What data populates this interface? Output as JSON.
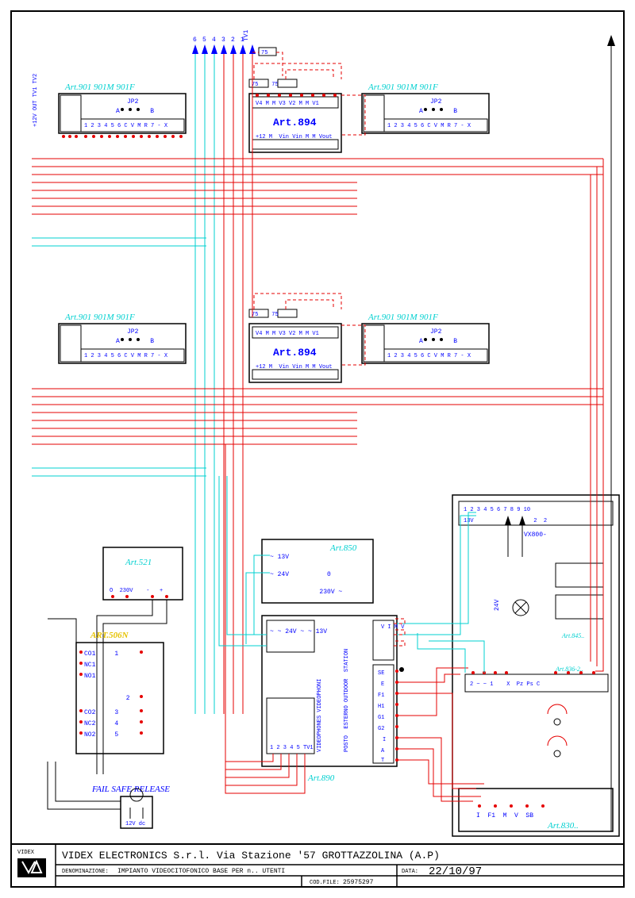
{
  "bus": {
    "labels": [
      "6",
      "5",
      "4",
      "3",
      "2",
      "1",
      "TV1"
    ],
    "resistor": "75"
  },
  "blocks": {
    "videophone": {
      "title": "Art.901 901M 901F",
      "jp2": "JP2",
      "ab": "A        B",
      "row_top": "+12V\nOUT\nTV1\nTV2",
      "row_bot": "1 2 3 4 5 6 C V M R 7 - X",
      "resistor": "75"
    },
    "art894": {
      "title": "Art.894",
      "top": "V4 M M V3 V2 M M V1",
      "bot": "+12 M  Vin Vin M M Vout",
      "resistors": "75    75"
    },
    "art521": {
      "title": "Art.521",
      "row": "O  230V    -   +"
    },
    "art506n": {
      "title": "ART.506N",
      "rows": [
        "CO1     1",
        "NC1",
        "NO1",
        "           2",
        "CO2     3",
        "NC2     4",
        "NO2     5"
      ]
    },
    "failsafe": {
      "title": "FAIL SAFE RELEASE",
      "sub": "12V dc"
    },
    "art850": {
      "title": "Art.850",
      "rows": [
        "~ 13V",
        "~ 24V          0",
        "             230V ~"
      ]
    },
    "art890": {
      "title": "Art.890",
      "side_video": "VIDEOPHONES\nVIDEOPHONI",
      "side_station": "POSTO  ESTERNO\nOUTDOOR  STATION",
      "left_top": "~ ~ 24V\n~ ~ 13V",
      "left_term": "1 2 3 4 5\nTV1",
      "right_term_v": "V\nI\nM\nV",
      "right_term_r": [
        "SE",
        "E",
        "F1",
        "H1",
        "G1",
        "G2",
        "I",
        "A",
        "T"
      ]
    },
    "vx800": {
      "title": "VX800-",
      "term": "1 2 3 4 5 6 7 8 9 10",
      "sub": "13V                  2  2",
      "lamp24": "24V"
    },
    "art845": {
      "title": "Art.845.."
    },
    "art836": {
      "title": "Art.836-2..",
      "term": "2 ~ ~ 1    X  Pz Ps C"
    },
    "art830": {
      "title": "Art.830..",
      "term": "I  F1  M  V  SB"
    }
  },
  "titleblock": {
    "company": "VIDEX ELECTRONICS S.r.l. Via Stazione '57 GROTTAZZOLINA (A.P)",
    "denom_lbl": "DENOMINAZIONE:",
    "denom": "IMPIANTO VIDEOCITOFONICO BASE PER n.. UTENTI",
    "data_lbl": "DATA:",
    "data": "22/10/97",
    "cod_lbl": "COD.FILE:",
    "cod": "25975297",
    "logo_top": "VIDEX"
  }
}
